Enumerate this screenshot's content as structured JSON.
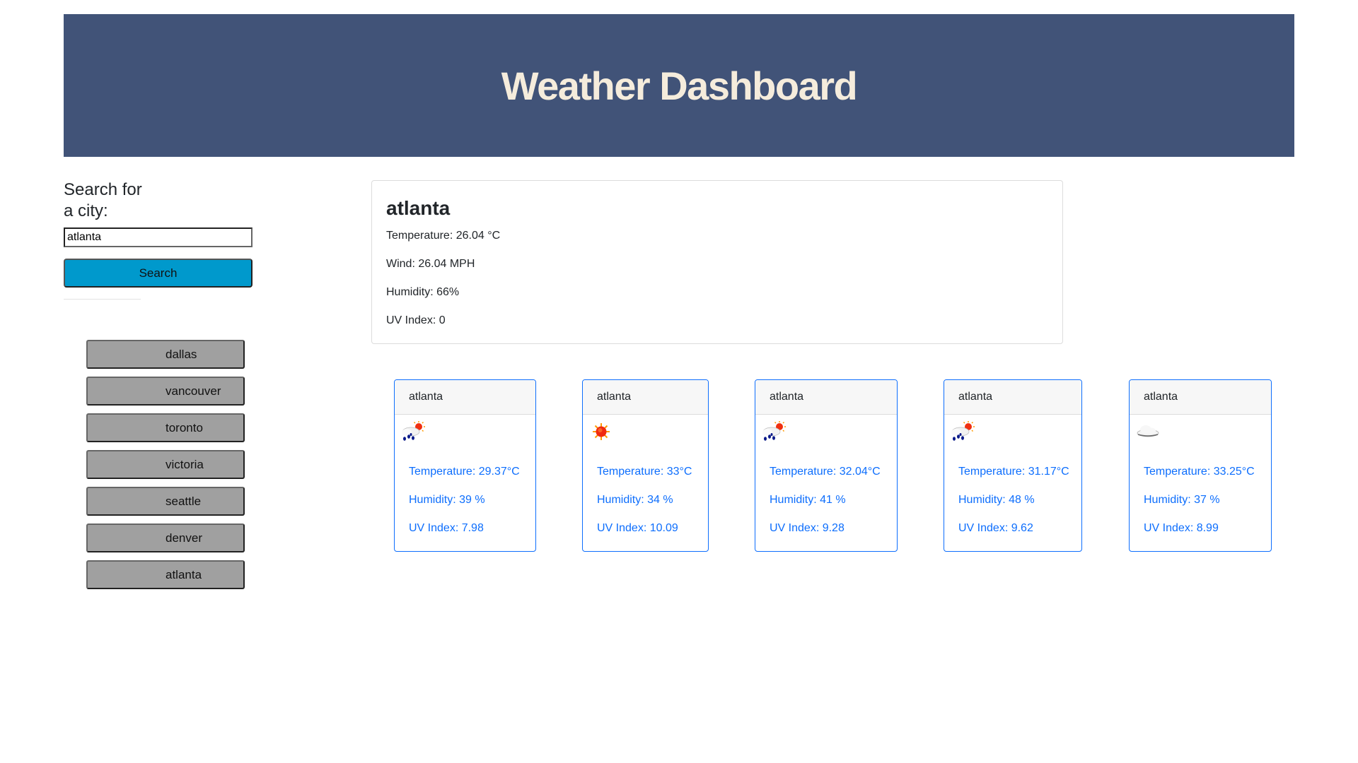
{
  "header": {
    "title": "Weather Dashboard"
  },
  "search": {
    "heading": "Search for a city:",
    "input_value": "atlanta",
    "button_label": "Search"
  },
  "history": [
    "dallas",
    "vancouver",
    "toronto",
    "victoria",
    "seattle",
    "denver",
    "atlanta"
  ],
  "current": {
    "city": "atlanta",
    "temperature": "Temperature: 26.04 °C",
    "wind": "Wind: 26.04 MPH",
    "humidity": "Humidity: 66%",
    "uv": "UV Index: 0"
  },
  "forecast": [
    {
      "city": "atlanta",
      "icon": "rain-sun-icon",
      "temperature": "Temperature: 29.37°C",
      "humidity": "Humidity: 39 %",
      "uv": "UV Index: 7.98"
    },
    {
      "city": "atlanta",
      "icon": "sun-icon",
      "temperature": "Temperature: 33°C",
      "humidity": "Humidity: 34 %",
      "uv": "UV Index: 10.09"
    },
    {
      "city": "atlanta",
      "icon": "rain-sun-icon",
      "temperature": "Temperature: 32.04°C",
      "humidity": "Humidity: 41 %",
      "uv": "UV Index: 9.28"
    },
    {
      "city": "atlanta",
      "icon": "rain-sun-icon",
      "temperature": "Temperature: 31.17°C",
      "humidity": "Humidity: 48 %",
      "uv": "UV Index: 9.62"
    },
    {
      "city": "atlanta",
      "icon": "cloud-icon",
      "temperature": "Temperature: 33.25°C",
      "humidity": "Humidity: 37 %",
      "uv": "UV Index: 8.99"
    }
  ],
  "colors": {
    "header_bg": "#415378",
    "header_text": "#f5ecdc",
    "search_button": "#0099cc",
    "history_button": "#a0a0a0",
    "forecast_accent": "#0d6efd"
  }
}
